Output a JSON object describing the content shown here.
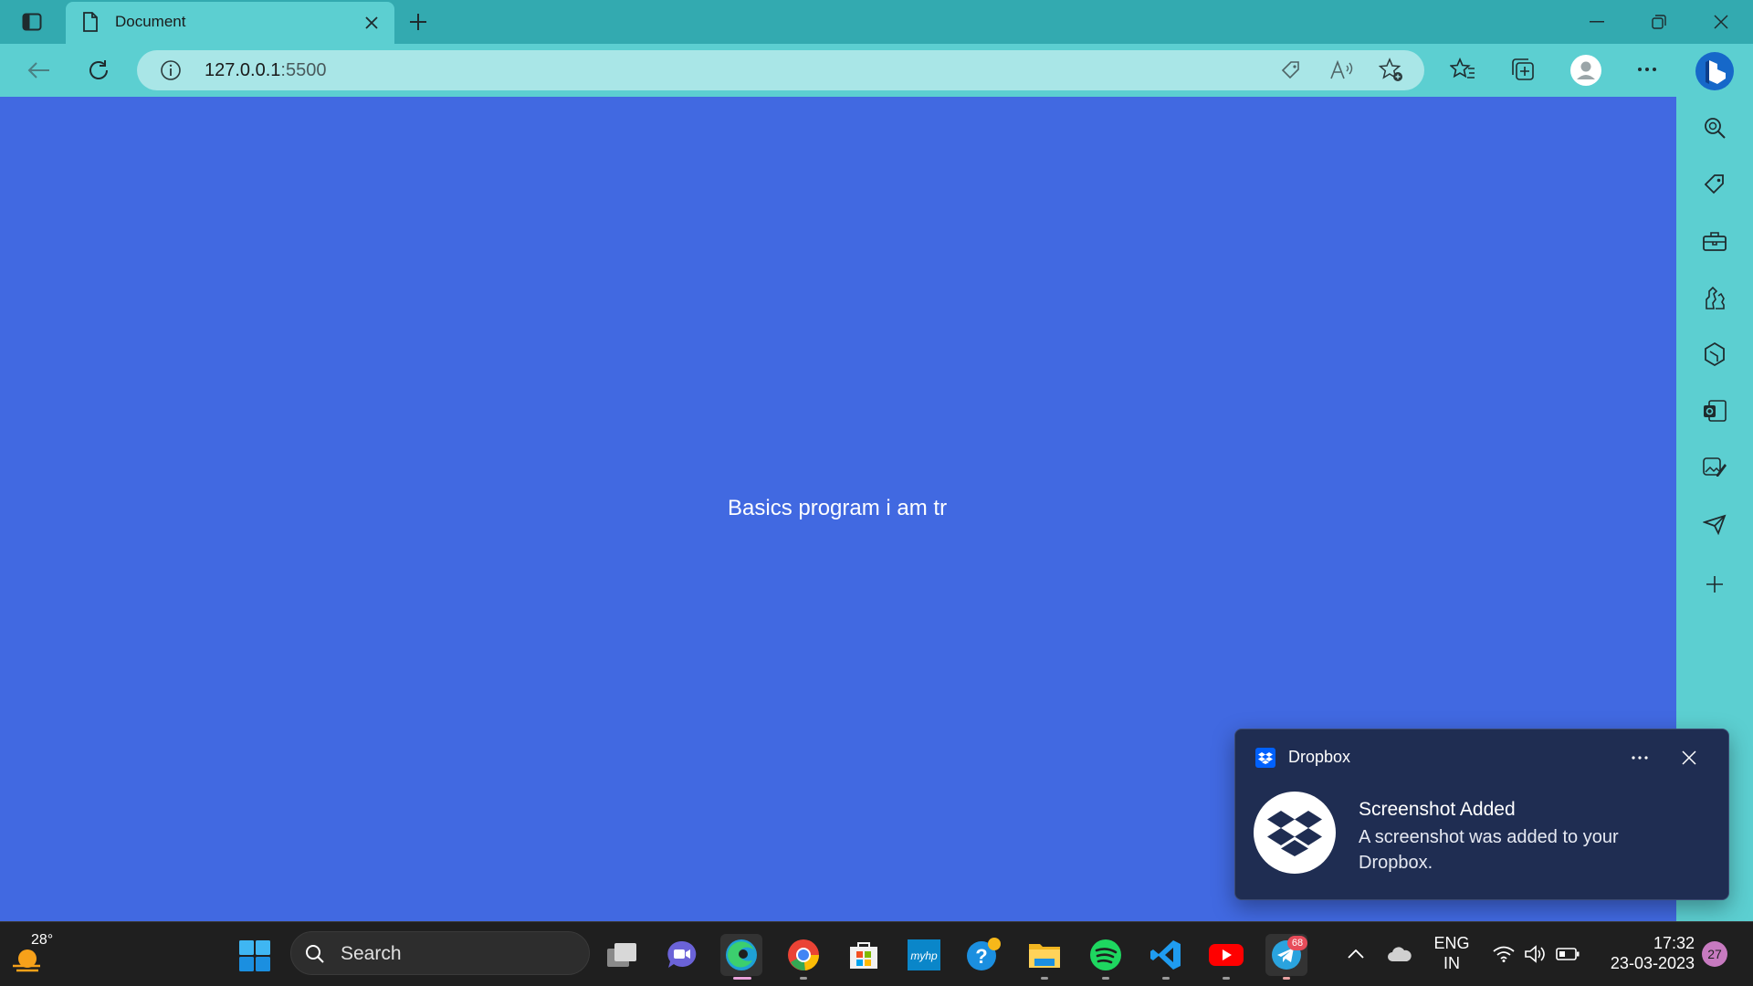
{
  "browser": {
    "tab_title": "Document",
    "url_host": "127.0.0.1",
    "url_port": ":5500"
  },
  "page": {
    "background": "#4169e1",
    "text": "Basics program i am tr"
  },
  "toast": {
    "app": "Dropbox",
    "title": "Screenshot Added",
    "body": "A screenshot was added to your Dropbox."
  },
  "taskbar": {
    "weather_temp": "28°",
    "search_label": "Search",
    "telegram_badge": "68",
    "language": "ENG",
    "region": "IN",
    "time": "17:32",
    "date": "23-03-2023",
    "notification_count": "27"
  },
  "colors": {
    "titlebar": "#33aab0",
    "toolbar": "#5ccfd1",
    "taskbar": "#1f1f1f",
    "toast": "#1f2d52"
  }
}
